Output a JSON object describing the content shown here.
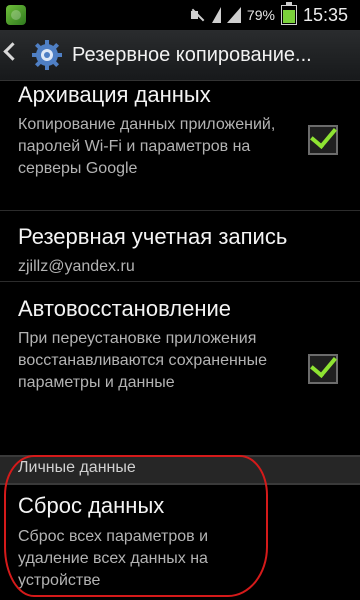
{
  "status_bar": {
    "battery_text": "79%",
    "time": "15:35",
    "battery_level": 0.79,
    "battery_color": "#7bd13b"
  },
  "action_bar": {
    "title": "Резервное копирование..."
  },
  "items": [
    {
      "title": "Архивация данных",
      "summary": "Копирование данных приложений, паролей Wi-Fi и параметров на серверы Google",
      "checked": true
    },
    {
      "title": "Резервная учетная запись",
      "summary": "zjillz@yandex.ru"
    },
    {
      "title": "Автовосстановление",
      "summary": "При переустановке приложения восстанавливаются сохраненные параметры и данные",
      "checked": true
    }
  ],
  "section": {
    "title": "Личные данные"
  },
  "reset": {
    "title": "Сброс данных",
    "summary": "Сброс всех параметров и удаление всех данных на устройстве"
  },
  "colors": {
    "check_mark": "#8ee332",
    "annotation_circle": "#d51a1a"
  }
}
